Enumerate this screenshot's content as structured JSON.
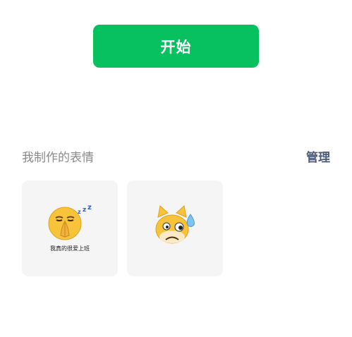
{
  "start_button": {
    "label": "开始"
  },
  "section": {
    "title": "我制作的表情",
    "manage_label": "管理"
  },
  "stickers": [
    {
      "icon": "praying-sleepy-emoji-icon",
      "caption": "我真的很爱上班"
    },
    {
      "icon": "sweating-cat-emoji-icon",
      "caption": ""
    }
  ],
  "colors": {
    "accent": "#07c160",
    "card_background": "#f5f5f5",
    "title_text": "#8a8a8a",
    "manage_text": "#4c5b7c"
  }
}
